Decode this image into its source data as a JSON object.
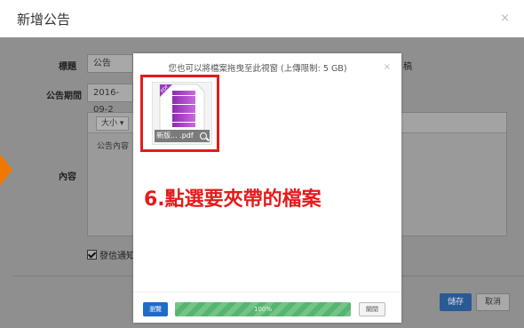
{
  "dialog": {
    "title": "新增公告",
    "close": "×"
  },
  "form": {
    "title_label": "標題",
    "title_value": "公告",
    "title_right_fragment": "稿",
    "period_label": "公告期間",
    "period_value": "2016-09-2",
    "content_label": "內容",
    "size_label": "大小 ▾",
    "content_text": "公告內容",
    "notify_label": "發信通知",
    "save_label": "儲存",
    "cancel_label": "取消"
  },
  "upload": {
    "title": "您也可以將檔案拖曳至此視窗 (上傳限制: 5 GB)",
    "close": "×",
    "file_name": "新版... .pdf",
    "file_badge": "PDF",
    "annotation": "6.點選要夾帶的檔案",
    "browse_label": "瀏覽",
    "progress_text": "100%",
    "progress_value": 1.0,
    "close_label": "關閉"
  },
  "colors": {
    "highlight": "#e31c1c",
    "arrow": "#f07800",
    "primary": "#1e6cc8",
    "progress": "#55b66f",
    "file_icon": "#b04cc8"
  }
}
